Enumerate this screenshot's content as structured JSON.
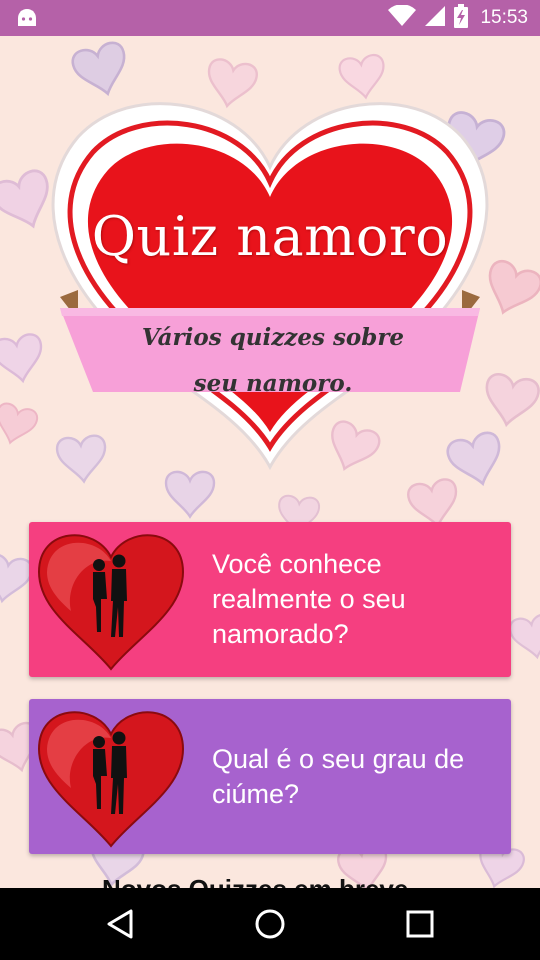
{
  "status_bar": {
    "time": "15:53",
    "bg_color": "#b561a8",
    "icons": [
      "android-icon",
      "wifi-icon",
      "signal-icon",
      "battery-icon"
    ]
  },
  "header": {
    "title": "Quiz namoro",
    "subtitle": "Vários quizzes sobre seu namoro."
  },
  "quizzes": [
    {
      "label": "Você conhece realmente o seu namorado?",
      "color": "#f53f80",
      "icon": "couple-heart-icon"
    },
    {
      "label": "Qual é o seu grau de ciúme?",
      "color": "#a762ce",
      "icon": "couple-heart-icon"
    }
  ],
  "footer": {
    "partial_text": "Novos Quizzes em breve"
  },
  "nav_bar": {
    "icons": [
      "back-icon",
      "home-icon",
      "recents-icon"
    ]
  },
  "colors": {
    "background": "#fbe7de",
    "heart_red": "#e8131b",
    "ribbon_pink": "#f7a0d8"
  }
}
